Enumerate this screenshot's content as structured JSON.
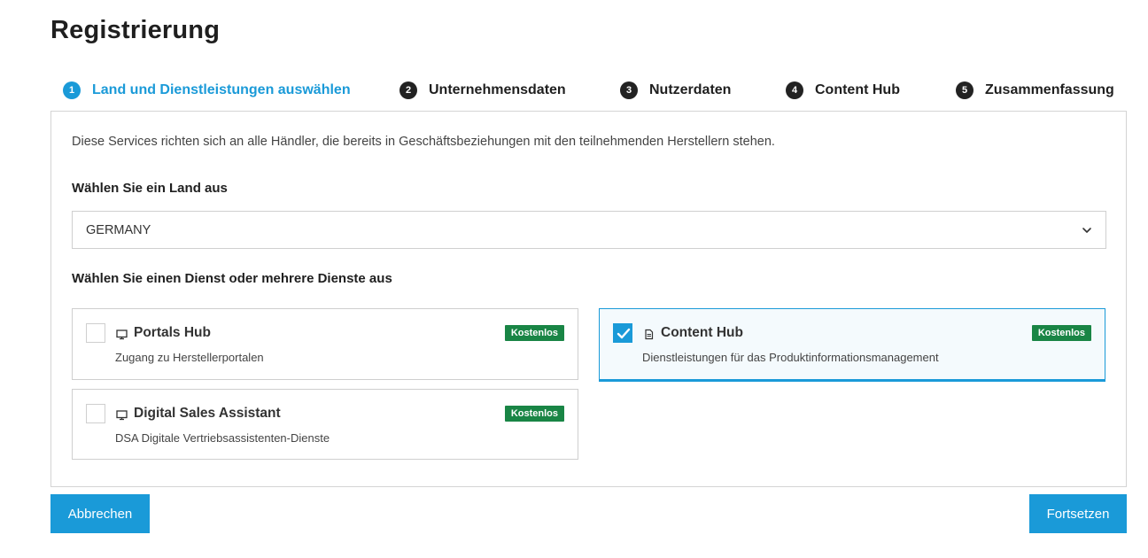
{
  "page": {
    "title": "Registrierung"
  },
  "stepper": {
    "steps": [
      {
        "num": "1",
        "label": "Land und Dienstleistungen auswählen",
        "active": true
      },
      {
        "num": "2",
        "label": "Unternehmensdaten",
        "active": false
      },
      {
        "num": "3",
        "label": "Nutzerdaten",
        "active": false
      },
      {
        "num": "4",
        "label": "Content Hub",
        "active": false
      },
      {
        "num": "5",
        "label": "Zusammenfassung",
        "active": false
      }
    ]
  },
  "panel": {
    "intro": "Diese Services richten sich an alle Händler, die bereits in Geschäftsbeziehungen mit den teilnehmenden Herstellern stehen.",
    "country_label": "Wählen Sie ein Land aus",
    "country_value": "GERMANY",
    "services_label": "Wählen Sie einen Dienst oder mehrere Dienste aus",
    "services": [
      {
        "title": "Portals Hub",
        "desc": "Zugang zu Herstellerportalen",
        "badge": "Kostenlos",
        "checked": false,
        "icon": "monitor-icon"
      },
      {
        "title": "Content Hub",
        "desc": "Dienstleistungen für das Produktinformationsmanagement",
        "badge": "Kostenlos",
        "checked": true,
        "icon": "document-icon"
      },
      {
        "title": "Digital Sales Assistant",
        "desc": "DSA Digitale Vertriebsassistenten-Dienste",
        "badge": "Kostenlos",
        "checked": false,
        "icon": "monitor-icon"
      }
    ]
  },
  "actions": {
    "cancel": "Abbrechen",
    "continue": "Fortsetzen"
  },
  "colors": {
    "accent": "#1a9ad8",
    "badge": "#198545"
  }
}
